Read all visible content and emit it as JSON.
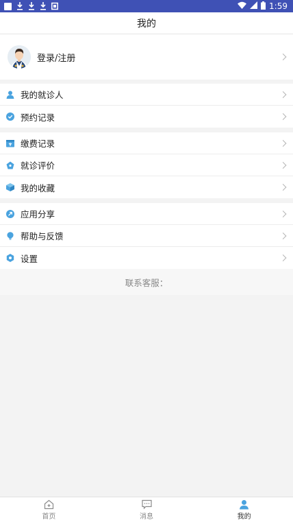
{
  "status_bar": {
    "time": "1:59"
  },
  "header": {
    "title": "我的"
  },
  "profile": {
    "login_label": "登录/注册"
  },
  "groups": [
    {
      "items": [
        {
          "label": "我的就诊人",
          "icon": "person-icon",
          "color": "#4aa3df"
        },
        {
          "label": "预约记录",
          "icon": "clock-check-icon",
          "color": "#4aa3df"
        }
      ]
    },
    {
      "items": [
        {
          "label": "缴费记录",
          "icon": "bill-icon",
          "color": "#4aa3df"
        },
        {
          "label": "就诊评价",
          "icon": "star-icon",
          "color": "#4aa3df"
        },
        {
          "label": "我的收藏",
          "icon": "box-icon",
          "color": "#4aa3df"
        }
      ]
    },
    {
      "items": [
        {
          "label": "应用分享",
          "icon": "share-icon",
          "color": "#4aa3df"
        },
        {
          "label": "帮助与反馈",
          "icon": "bulb-icon",
          "color": "#4aa3df"
        },
        {
          "label": "设置",
          "icon": "gear-icon",
          "color": "#4aa3df"
        }
      ]
    }
  ],
  "contact": {
    "label": "联系客服："
  },
  "bottom_nav": {
    "tabs": [
      {
        "label": "首页",
        "icon": "home-icon",
        "active": false
      },
      {
        "label": "消息",
        "icon": "message-icon",
        "active": false
      },
      {
        "label": "我的",
        "icon": "user-icon",
        "active": true
      }
    ]
  },
  "colors": {
    "accent": "#4aa3df",
    "status_bar": "#3f51b5"
  }
}
